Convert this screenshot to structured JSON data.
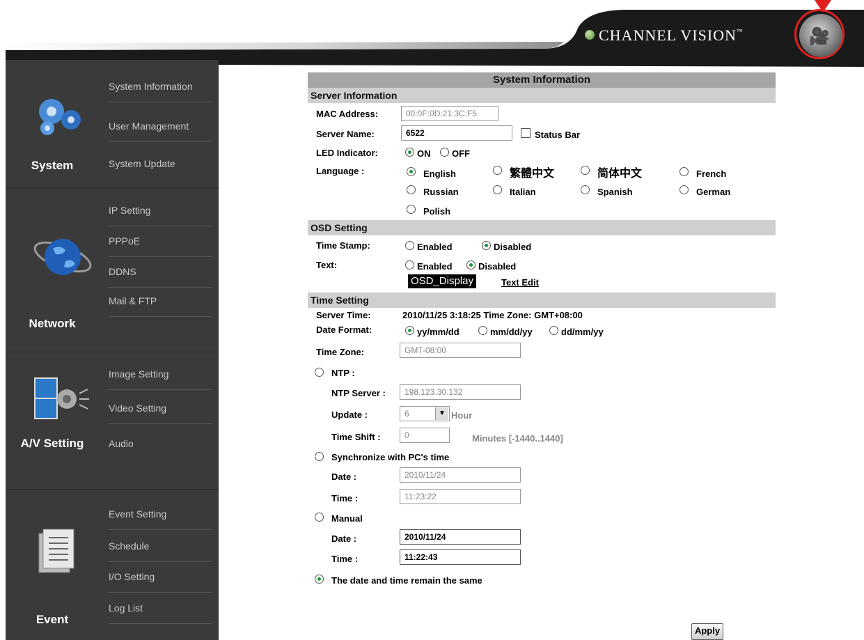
{
  "header": {
    "brand": "CHANNEL VISION",
    "tm": "™"
  },
  "sidebar": {
    "groups": [
      {
        "title": "System",
        "items": [
          "System Information",
          "User Management",
          "System Update"
        ]
      },
      {
        "title": "Network",
        "items": [
          "IP Setting",
          "PPPoE",
          "DDNS",
          "Mail & FTP"
        ]
      },
      {
        "title": "A/V Setting",
        "items": [
          "Image Setting",
          "Video Setting",
          "Audio"
        ]
      },
      {
        "title": "Event",
        "items": [
          "Event Setting",
          "Schedule",
          "I/O Setting",
          "Log List"
        ]
      }
    ]
  },
  "page": {
    "title": "System Information",
    "server": {
      "section": "Server Information",
      "mac_label": "MAC Address:",
      "mac_value": "00:0F:0D:21:3C:F5",
      "name_label": "Server Name:",
      "name_value": "6522",
      "status_bar": "Status Bar",
      "led_label": "LED Indicator:",
      "led_on": "ON",
      "led_off": "OFF",
      "lang_label": "Language :",
      "languages": [
        "English",
        "繁體中文",
        "简体中文",
        "French",
        "Russian",
        "Italian",
        "Spanish",
        "German",
        "Polish"
      ],
      "selected_language": "English"
    },
    "osd": {
      "section": "OSD Setting",
      "ts_label": "Time Stamp:",
      "text_label": "Text:",
      "enabled": "Enabled",
      "disabled": "Disabled",
      "osd_text": "OSD_Display",
      "text_edit": "Text Edit"
    },
    "time": {
      "section": "Time Setting",
      "server_time_label": "Server Time:",
      "server_time_value": "2010/11/25 3:18:25 Time Zone: GMT+08:00",
      "date_format_label": "Date Format:",
      "formats": [
        "yy/mm/dd",
        "mm/dd/yy",
        "dd/mm/yy"
      ],
      "tz_label": "Time Zone:",
      "tz_value": "GMT-08:00",
      "ntp_label": "NTP :",
      "ntp_server_label": "NTP Server :",
      "ntp_server_value": "198.123.30.132",
      "update_label": "Update :",
      "update_value": "6",
      "update_unit": "Hour",
      "shift_label": "Time Shift :",
      "shift_value": "0",
      "shift_unit": "Minutes  [-1440..1440]",
      "sync_label": "Synchronize with PC's time",
      "date_label": "Date :",
      "time_label": "Time :",
      "pc_date": "2010/11/24",
      "pc_time": "11:23:22",
      "manual_label": "Manual",
      "manual_date": "2010/11/24",
      "manual_time": "11:22:43",
      "remain_label": "The date and time remain the same"
    },
    "apply": "Apply"
  }
}
